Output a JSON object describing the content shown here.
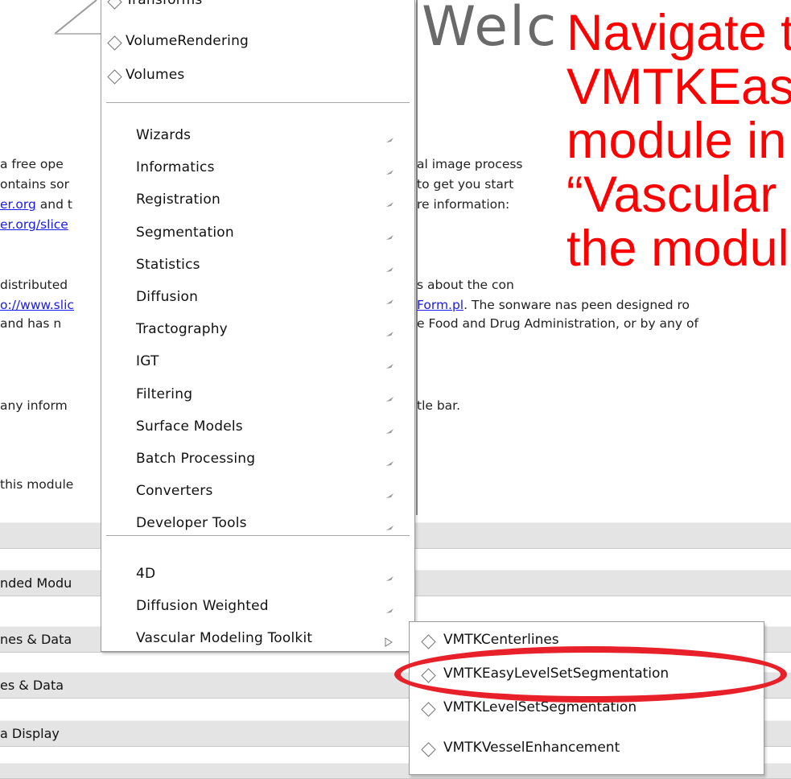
{
  "background": {
    "welcome_heading": "Welc",
    "lines": [
      {
        "text": "a free ope"
      },
      {
        "text": "ontains sor"
      },
      {
        "text": "er.org",
        "suffix": " and t"
      },
      {
        "text": "er.org/slice"
      },
      {
        "text": "distributed"
      },
      {
        "text": "o://www.slic"
      },
      {
        "text": " and has n"
      },
      {
        "text": "any inform"
      },
      {
        "text": "this module"
      }
    ],
    "right_lines": [
      "al image process",
      "to get you start",
      "re information:",
      "s about the con",
      "Form.pl",
      ". The sonware nas peen designed ro",
      "e Food and Drug Administration, or by any of",
      "tle bar."
    ],
    "panels": [
      {
        "label": ""
      },
      {
        "label": "nded Modu"
      },
      {
        "label": "nes & Data"
      },
      {
        "label": "es & Data"
      },
      {
        "label": "a Display"
      },
      {
        "label": ""
      }
    ]
  },
  "menu": {
    "radio_items": [
      {
        "label": "Transforms"
      },
      {
        "label": "VolumeRendering"
      },
      {
        "label": "Volumes"
      }
    ],
    "category_items": [
      {
        "label": "Wizards"
      },
      {
        "label": "Informatics"
      },
      {
        "label": "Registration"
      },
      {
        "label": "Segmentation"
      },
      {
        "label": "Statistics"
      },
      {
        "label": "Diffusion"
      },
      {
        "label": "Tractography"
      },
      {
        "label": "IGT"
      },
      {
        "label": "Filtering"
      },
      {
        "label": "Surface Models"
      },
      {
        "label": "Batch Processing"
      },
      {
        "label": "Converters"
      },
      {
        "label": "Developer Tools"
      }
    ],
    "extension_items": [
      {
        "label": "4D"
      },
      {
        "label": "Diffusion Weighted"
      },
      {
        "label": "Vascular Modeling Toolkit"
      }
    ]
  },
  "submenu": {
    "items": [
      {
        "label": "VMTKCenterlines"
      },
      {
        "label": "VMTKEasyLevelSetSegmentation"
      },
      {
        "label": "VMTKLevelSetSegmentation"
      },
      {
        "label": "VMTKVesselEnhancement"
      }
    ]
  },
  "annotation": {
    "text": "Navigate t\nVMTKEas\nmodule in\n“Vascular\nthe modul",
    "color": "#ff0000",
    "highlight_color": "#e8202a"
  },
  "colors": {
    "menu_bg": "#ffffff",
    "panel_bg": "#e4e4e4",
    "link": "#1a1aee"
  }
}
